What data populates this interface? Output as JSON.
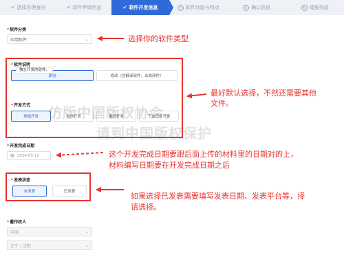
{
  "steps": [
    {
      "label": "选择办理身份",
      "state": "done"
    },
    {
      "label": "软件申请信息",
      "state": "done"
    },
    {
      "label": "软件开发信息",
      "state": "active"
    },
    {
      "label": "软件功能与特点",
      "num": "4"
    },
    {
      "label": "确认信息",
      "num": "5"
    },
    {
      "label": "错报完成",
      "num": "6"
    }
  ],
  "form": {
    "category": {
      "label": "软件分类",
      "value": "应用软件"
    },
    "description": {
      "label": "软件说明",
      "tooltip": "独立开发的软件。",
      "options": [
        "原创",
        "修改（含翻译软件、合成软件）"
      ]
    },
    "dev_method": {
      "label": "开发方式",
      "options": [
        "单独开发",
        "合作开发",
        "委托开发",
        "下达任务开发"
      ]
    },
    "finish_date": {
      "label": "开发完成日期",
      "value": "2024-05-15"
    },
    "publish_status": {
      "label": "发表状态",
      "options": [
        "未发表",
        "已发表"
      ]
    },
    "rights_holder": {
      "label": "著作权人",
      "country": "中国",
      "region": "辽宁 / 沈阳"
    }
  },
  "annotations": {
    "note1": "选择你的软件类型",
    "note2_line1": "最好默认选择，不然还需要其他",
    "note2_line2": "文件。",
    "note3_line1": "这个开发完成日期要跟后面上传的材料里的日期对的上，",
    "note3_line2": "材料编写日期要在开发完成日期之后",
    "note4_line1": "如果选择已发表需要填写发表日期、发表平台等，择",
    "note4_line2": "请选择。"
  },
  "watermark": {
    "line1": "仿版中国版权协会，",
    "line2": "请到中国版权保护"
  },
  "colors": {
    "accent": "#2f6bd8",
    "annotation_red": "#e8332f"
  }
}
